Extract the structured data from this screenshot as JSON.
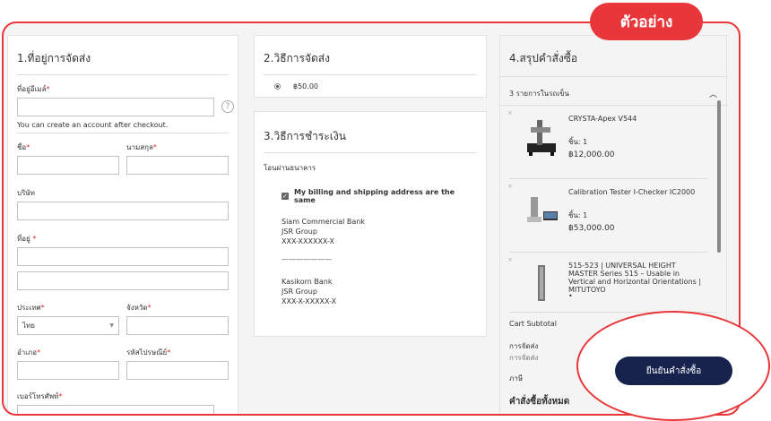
{
  "badge": "ตัวอย่าง",
  "shipping_address": {
    "title": "1.ที่อยู่การจัดส่ง",
    "email_label": "ที่อยู่อีเมล์",
    "email_help": "You can create an account after checkout.",
    "first_name_label": "ชื่อ",
    "last_name_label": "นามสกุล",
    "company_label": "บริษัท",
    "street_label": "ที่อยู่",
    "country_label": "ประเทศ",
    "country_value": "ไทย",
    "province_label": "จังหวัด",
    "district_label": "อำเภอ",
    "postcode_label": "รหัสไปรษณีย์",
    "phone_label": "เบอร์โทรศัพท์",
    "required_mark": "*",
    "help_icon": "?"
  },
  "shipping_method": {
    "title": "2.วิธีการจัดส่ง",
    "option_price": "฿50.00"
  },
  "payment": {
    "title": "3.วิธีการชำระเงิน",
    "method": "โอนผ่านธนาคาร",
    "same_address_label": "My billing and shipping address are the same",
    "banks": [
      [
        "Siam Commercial Bank",
        "JSR Group",
        "XXX-XXXXXX-X"
      ],
      [
        "Kasikorn Bank",
        "JSR Group",
        "XXX-X-XXXXX-X"
      ]
    ],
    "separator": "———————"
  },
  "summary": {
    "title": "4.สรุปคำสั่งซื้อ",
    "cart_toggle": "3 รายการในรถเข็น",
    "items": [
      {
        "name": "CRYSTA-Apex V544",
        "qty": "ชิ้น: 1",
        "price": "฿12,000.00"
      },
      {
        "name": "Calibration Tester I-Checker IC2000",
        "qty": "ชิ้น: 1",
        "price": "฿53,000.00"
      },
      {
        "name": "515-523 | UNIVERSAL HEIGHT MASTER Series 515 – Usable in Vertical and Horizontal Orientations | MITUTOYO",
        "qty": "",
        "price": ""
      }
    ],
    "remove_icon": "×",
    "subtotal_label": "Cart Subtotal",
    "shipping_label": "การจัดส่ง",
    "shipping_sub": "การจัดส่ง",
    "tax_label": "ภาษี",
    "grand_total_label": "คำสั่งซื้อทั้งหมด",
    "confirm_button": "ยืนยันคำสั่งซื้อ"
  },
  "colors": {
    "accent": "#e8373b",
    "button": "#17234d"
  }
}
